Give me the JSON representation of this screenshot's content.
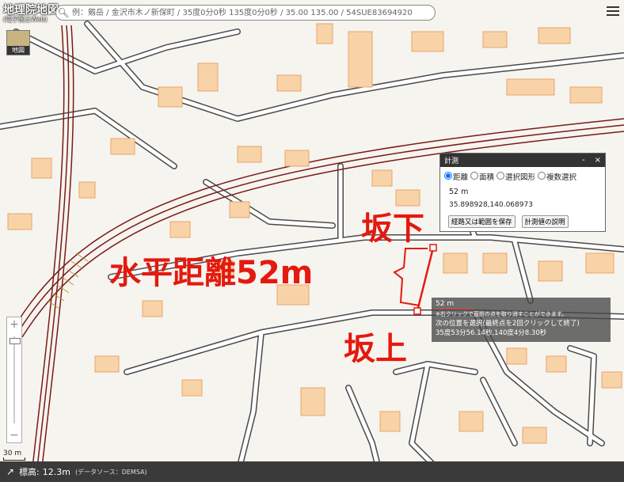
{
  "app": {
    "title": "地理院地図",
    "subtitle": "(電子国土Web)"
  },
  "search": {
    "placeholder": "例：剱岳 / 金沢市木ノ新保町 / 35度0分0秒 135度0分0秒 / 35.00 135.00 / 54SUE83694920"
  },
  "icons": {
    "search": "search-icon",
    "menu": "menu-icon",
    "elevation_arrow": "arrow-icon",
    "layers": "map-layer-icon"
  },
  "layer_button": {
    "label": "地図"
  },
  "zoom": {
    "in": "+",
    "out": "−"
  },
  "scale": {
    "label": "30 m"
  },
  "footer": {
    "elevation_label": "標高:",
    "elevation_value": "12.3m",
    "source": "(データソース：DEMSA)"
  },
  "measure_panel": {
    "title": "計測",
    "minimize": "-",
    "close": "×",
    "options": [
      "距離",
      "面積",
      "選択図形",
      "複数選択"
    ],
    "selected": "距離",
    "distance": "52 m",
    "coordinates": "35.898928,140.068973",
    "save_button": "経路又は範囲を保存",
    "help_button": "計測値の説明"
  },
  "tooltip": {
    "distance": "52 m",
    "note": "※右クリックで直前の点を取り消すことができます。",
    "instruction": "次の位置を選択(最終点を2回クリックして終了)",
    "position": "35度53分56.14秒,140度4分8.30秒"
  },
  "annotations": {
    "horizontal_distance": "水平距離52m",
    "slope_bottom": "坂下",
    "slope_top": "坂上"
  },
  "colors": {
    "building": "#f8d3a8",
    "building_edge": "#e9a46c",
    "road_edge": "#4a4a4a",
    "railway": "#7a1a1a",
    "annotation": "#e4190f",
    "measure_line": "#e4190f"
  }
}
